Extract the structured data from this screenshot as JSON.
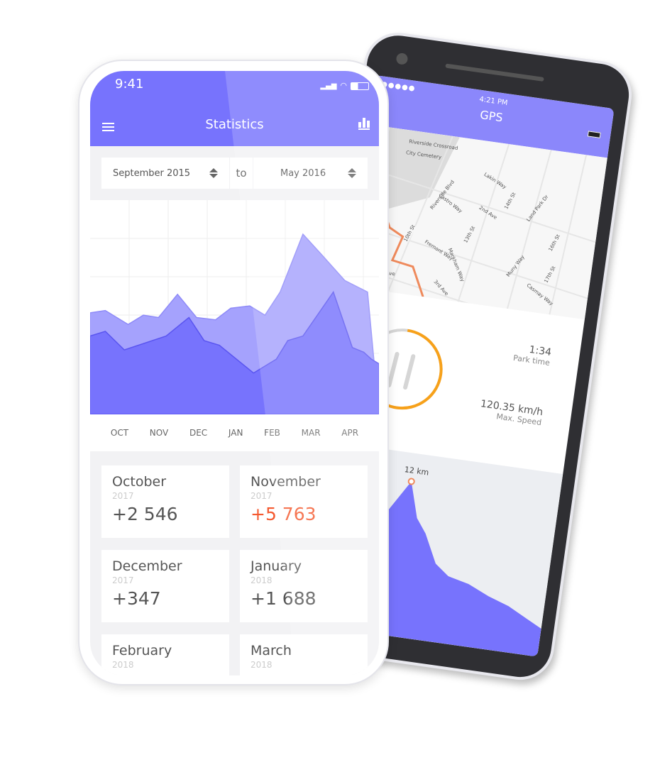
{
  "gps_phone": {
    "status_time": "4:21 PM",
    "title": "GPS",
    "signal_dots": 5,
    "map_labels": [
      "Riverside Crossroad",
      "City Cemetery",
      "Riverside Blvd",
      "Castro Way",
      "Lakin Way",
      "2nd Ave",
      "13th St",
      "14th St",
      "Land Park Dr",
      "Fremont Way",
      "Markham Way",
      "Muny Way",
      "16th St",
      "17th St",
      "10th St",
      "4th Ave",
      "3rd Ave",
      "Casmay Way"
    ],
    "progress_ring_percent": 60,
    "accent": "#f7a11a",
    "route_color": "#ef8a5c",
    "park_time": {
      "value": "1:34",
      "label": "Park time"
    },
    "max_speed": {
      "value": "120.35 km/h",
      "label": "Max. Speed"
    },
    "elevation_peak_label": "12 km"
  },
  "stats_phone": {
    "status_time": "9:41",
    "title": "Statistics",
    "menu_icon": "hamburger-icon",
    "chart_icon": "bar-chart-icon",
    "range": {
      "from": "September 2015",
      "separator": "to",
      "to": "May 2016"
    },
    "accent": "#7773fd",
    "highlight": "#f4592f",
    "cards": [
      {
        "month": "October",
        "year": "2017",
        "value": "+2 546"
      },
      {
        "month": "November",
        "year": "2017",
        "value": "+5 763",
        "highlight": true
      },
      {
        "month": "December",
        "year": "2017",
        "value": "+347"
      },
      {
        "month": "January",
        "year": "2018",
        "value": "+1 688"
      },
      {
        "month": "February",
        "year": "2018",
        "value": ""
      },
      {
        "month": "March",
        "year": "2018",
        "value": ""
      }
    ]
  },
  "chart_data": {
    "type": "area",
    "categories": [
      "OCT",
      "NOV",
      "DEC",
      "JAN",
      "FEB",
      "MAR",
      "APR"
    ],
    "grid": true,
    "ylim": [
      0,
      100
    ],
    "series": [
      {
        "color": "#a5a2fd",
        "x": [
          0,
          0.4,
          1,
          1.4,
          1.8,
          2.3,
          2.8,
          3.3,
          3.7,
          4.2,
          4.6,
          5.0,
          5.6,
          6.1,
          6.7,
          7.3
        ],
        "values": [
          50,
          51,
          45,
          49,
          48,
          58,
          48,
          47,
          52,
          53,
          49,
          59,
          84,
          75,
          64,
          59
        ]
      },
      {
        "color": "#7773fd",
        "x": [
          0,
          0.4,
          0.9,
          2,
          2.6,
          3.0,
          3.4,
          4.3,
          4.9,
          5.2,
          5.6,
          6.4,
          6.9,
          7.2,
          7.4,
          7.6
        ],
        "values": [
          40,
          42,
          34,
          40,
          48,
          38,
          36,
          24,
          30,
          38,
          40,
          59,
          35,
          33,
          30,
          28
        ]
      }
    ]
  }
}
